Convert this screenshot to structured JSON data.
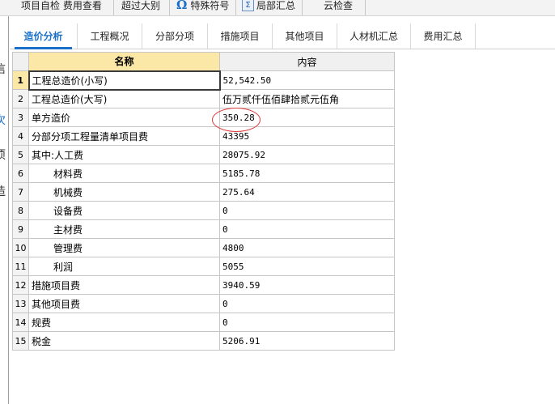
{
  "toolbar": {
    "items": [
      {
        "label": "项目自检   费用查看"
      },
      {
        "label": "超过大别"
      },
      {
        "label": "特殊符号",
        "icon": "omega-icon"
      },
      {
        "label": "局部汇总",
        "icon": "sigma-icon"
      },
      {
        "label": "云检查"
      }
    ]
  },
  "left_panel": {
    "chars": [
      "信",
      "次",
      "项",
      "造"
    ]
  },
  "tabs": [
    {
      "label": "造价分析",
      "active": true
    },
    {
      "label": "工程概况"
    },
    {
      "label": "分部分项"
    },
    {
      "label": "措施项目"
    },
    {
      "label": "其他项目"
    },
    {
      "label": "人材机汇总"
    },
    {
      "label": "费用汇总"
    }
  ],
  "table": {
    "headers": {
      "name": "名称",
      "content": "内容"
    },
    "rows": [
      {
        "no": "1",
        "name": "工程总造价(小写)",
        "value": "52,542.50"
      },
      {
        "no": "2",
        "name": "工程总造价(大写)",
        "value": "伍万贰仟伍佰肆拾贰元伍角"
      },
      {
        "no": "3",
        "name": "单方造价",
        "value": "350.28"
      },
      {
        "no": "4",
        "name": "分部分项工程量清单项目费",
        "value": "43395"
      },
      {
        "no": "5",
        "name": "其中:人工费",
        "value": "28075.92"
      },
      {
        "no": "6",
        "name": "材料费",
        "value": "5185.78"
      },
      {
        "no": "7",
        "name": "机械费",
        "value": "275.64"
      },
      {
        "no": "8",
        "name": "设备费",
        "value": "0"
      },
      {
        "no": "9",
        "name": "主材费",
        "value": "0"
      },
      {
        "no": "10",
        "name": "管理费",
        "value": "4800"
      },
      {
        "no": "11",
        "name": "利润",
        "value": "5055"
      },
      {
        "no": "12",
        "name": "措施项目费",
        "value": "3940.59"
      },
      {
        "no": "13",
        "name": "其他项目费",
        "value": "0"
      },
      {
        "no": "14",
        "name": "规费",
        "value": "0"
      },
      {
        "no": "15",
        "name": "税金",
        "value": "5206.91"
      }
    ]
  },
  "colors": {
    "accent": "#1a6fc8",
    "header_highlight": "#fbe8a6",
    "annotation": "#e03a3a"
  }
}
